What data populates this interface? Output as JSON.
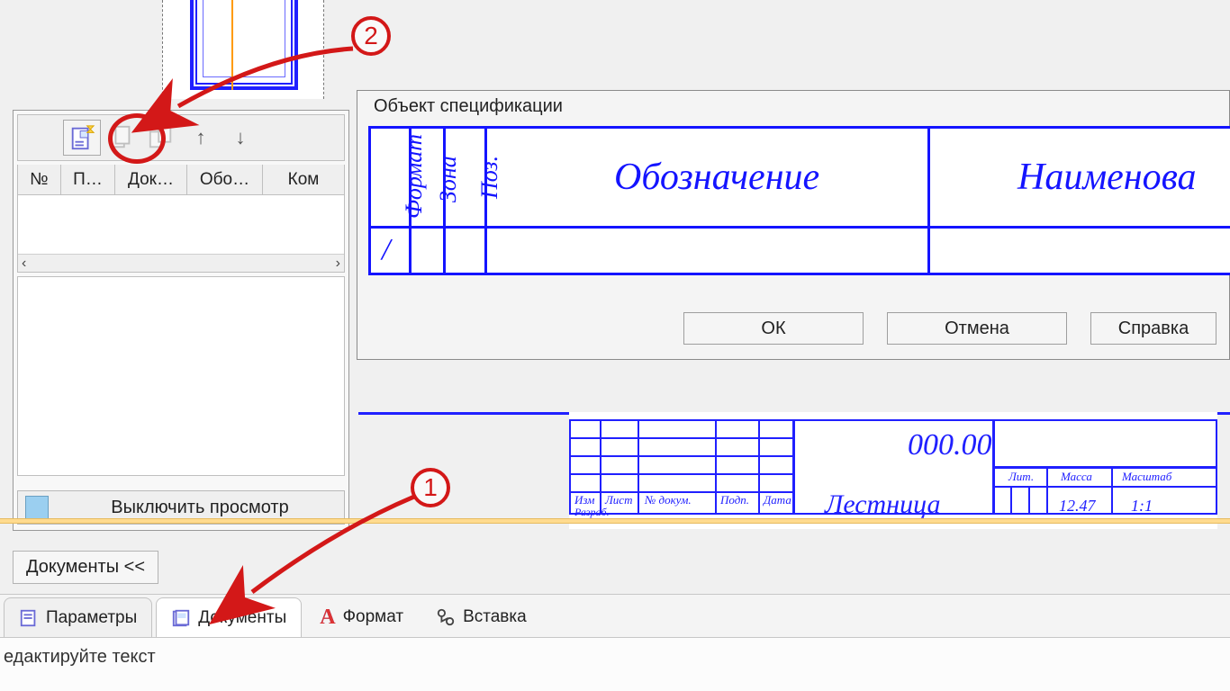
{
  "panel": {
    "headers": [
      "№",
      "П…",
      "Док…",
      "Обо…",
      "Ком"
    ],
    "footer_label": "Выключить просмотр"
  },
  "dialog": {
    "title": "Объект спецификации",
    "cols": {
      "format": "Формат",
      "zone": "Зона",
      "pos": "Поз.",
      "designation": "Обозначение",
      "name": "Наименова"
    },
    "row1_format": "/",
    "buttons": {
      "ok": "ОК",
      "cancel": "Отмена",
      "help": "Справка"
    }
  },
  "titleblock": {
    "code": "000.00",
    "hdrs": {
      "izm": "Изм",
      "list": "Лист",
      "ndoc": "№ докум.",
      "podp": "Подп.",
      "data": "Дата",
      "lit": "Лит.",
      "massa": "Масса",
      "masht": "Масштаб"
    },
    "name_partial": "Лестница",
    "massa_val": "12.47",
    "masht_val": "1:1",
    "razrab": "Разраб."
  },
  "doc_tab": "Документы  <<",
  "tabs": {
    "params": "Параметры",
    "docs": "Документы",
    "format": "Формат",
    "insert": "Вставка"
  },
  "status": "едактируйте текст",
  "anno": {
    "n1": "1",
    "n2": "2"
  }
}
